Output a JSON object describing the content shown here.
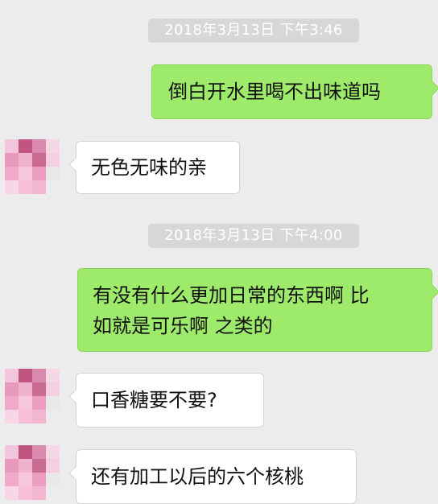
{
  "chat": {
    "timestamps": [
      "2018年3月13日 下午3:46",
      "2018年3月13日 下午4:00"
    ],
    "messages": [
      {
        "from": "me",
        "text": "倒白开水里喝不出味道吗"
      },
      {
        "from": "them",
        "text": "无色无味的亲"
      },
      {
        "from": "me",
        "text_lines": [
          "有没有什么更加日常的东西啊 比",
          "如就是可乐啊 之类的"
        ]
      },
      {
        "from": "them",
        "text": "口香糖要不要?"
      },
      {
        "from": "them",
        "text": "还有加工以后的六个核桃"
      }
    ]
  },
  "colors": {
    "background": "#ececec",
    "sent_bubble": "#9eea6a",
    "received_bubble": "#ffffff",
    "timestamp_pill": "#d7d7d7"
  },
  "icons": {
    "avatar": "pixelated-avatar-icon"
  }
}
